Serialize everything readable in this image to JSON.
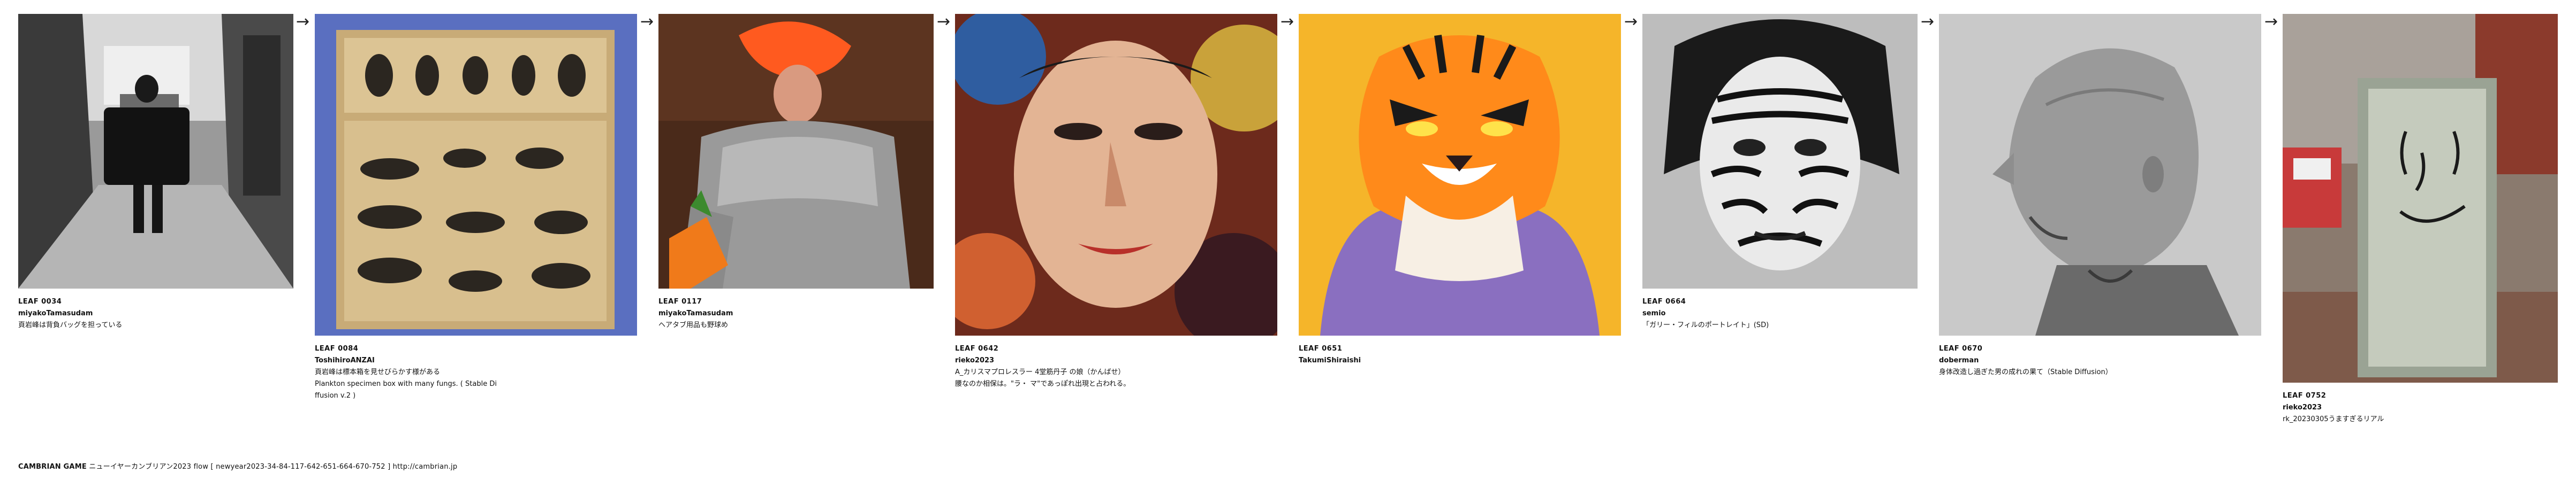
{
  "leaves": [
    {
      "id": "LEAF 0034",
      "author": "miyakoTamasudam",
      "title": "頁岩峰は背負バッグを担っている",
      "icon": "street-photo"
    },
    {
      "id": "LEAF 0084",
      "author": "ToshihiroANZAI",
      "title": "頁岩峰は標本箱を見せびらかす様がある\nPlankton specimen box with many fungs. ( Stable Di\nffusion v.2 )",
      "icon": "specimen-box"
    },
    {
      "id": "LEAF 0117",
      "author": "miyakoTamasudam",
      "title": "ヘアタブ用品も野球め",
      "icon": "armor-carrot"
    },
    {
      "id": "LEAF 0642",
      "author": "rieko2023",
      "title": "A_カリスマプロレスラー 4堂筋丹子 の娘（かんばせ）\n腰なのか相保は。\"ラ・ マ\"であっぽれ出現と占われる。",
      "icon": "painted-face"
    },
    {
      "id": "LEAF 0651",
      "author": "TakumiShiraishi",
      "title": "",
      "icon": "tiger"
    },
    {
      "id": "LEAF 0664",
      "author": "semio",
      "title": "「ガリー・フィルのポートレイト」(SD)",
      "icon": "zebra-face"
    },
    {
      "id": "LEAF 0670",
      "author": "doberman",
      "title": "身体改造し過ぎた男の成れの果て（Stable Diffusion）",
      "icon": "bald-man"
    },
    {
      "id": "LEAF 0752",
      "author": "rieko2023",
      "title": "rk_20230305うますぎるリアル",
      "icon": "smiley-board"
    }
  ],
  "footer": {
    "brand": "CAMBRIAN GAME",
    "text": "ニューイヤーカンブリアン2023  flow [ newyear2023-34-84-117-642-651-664-670-752 ]    http://cambrian.jp"
  }
}
